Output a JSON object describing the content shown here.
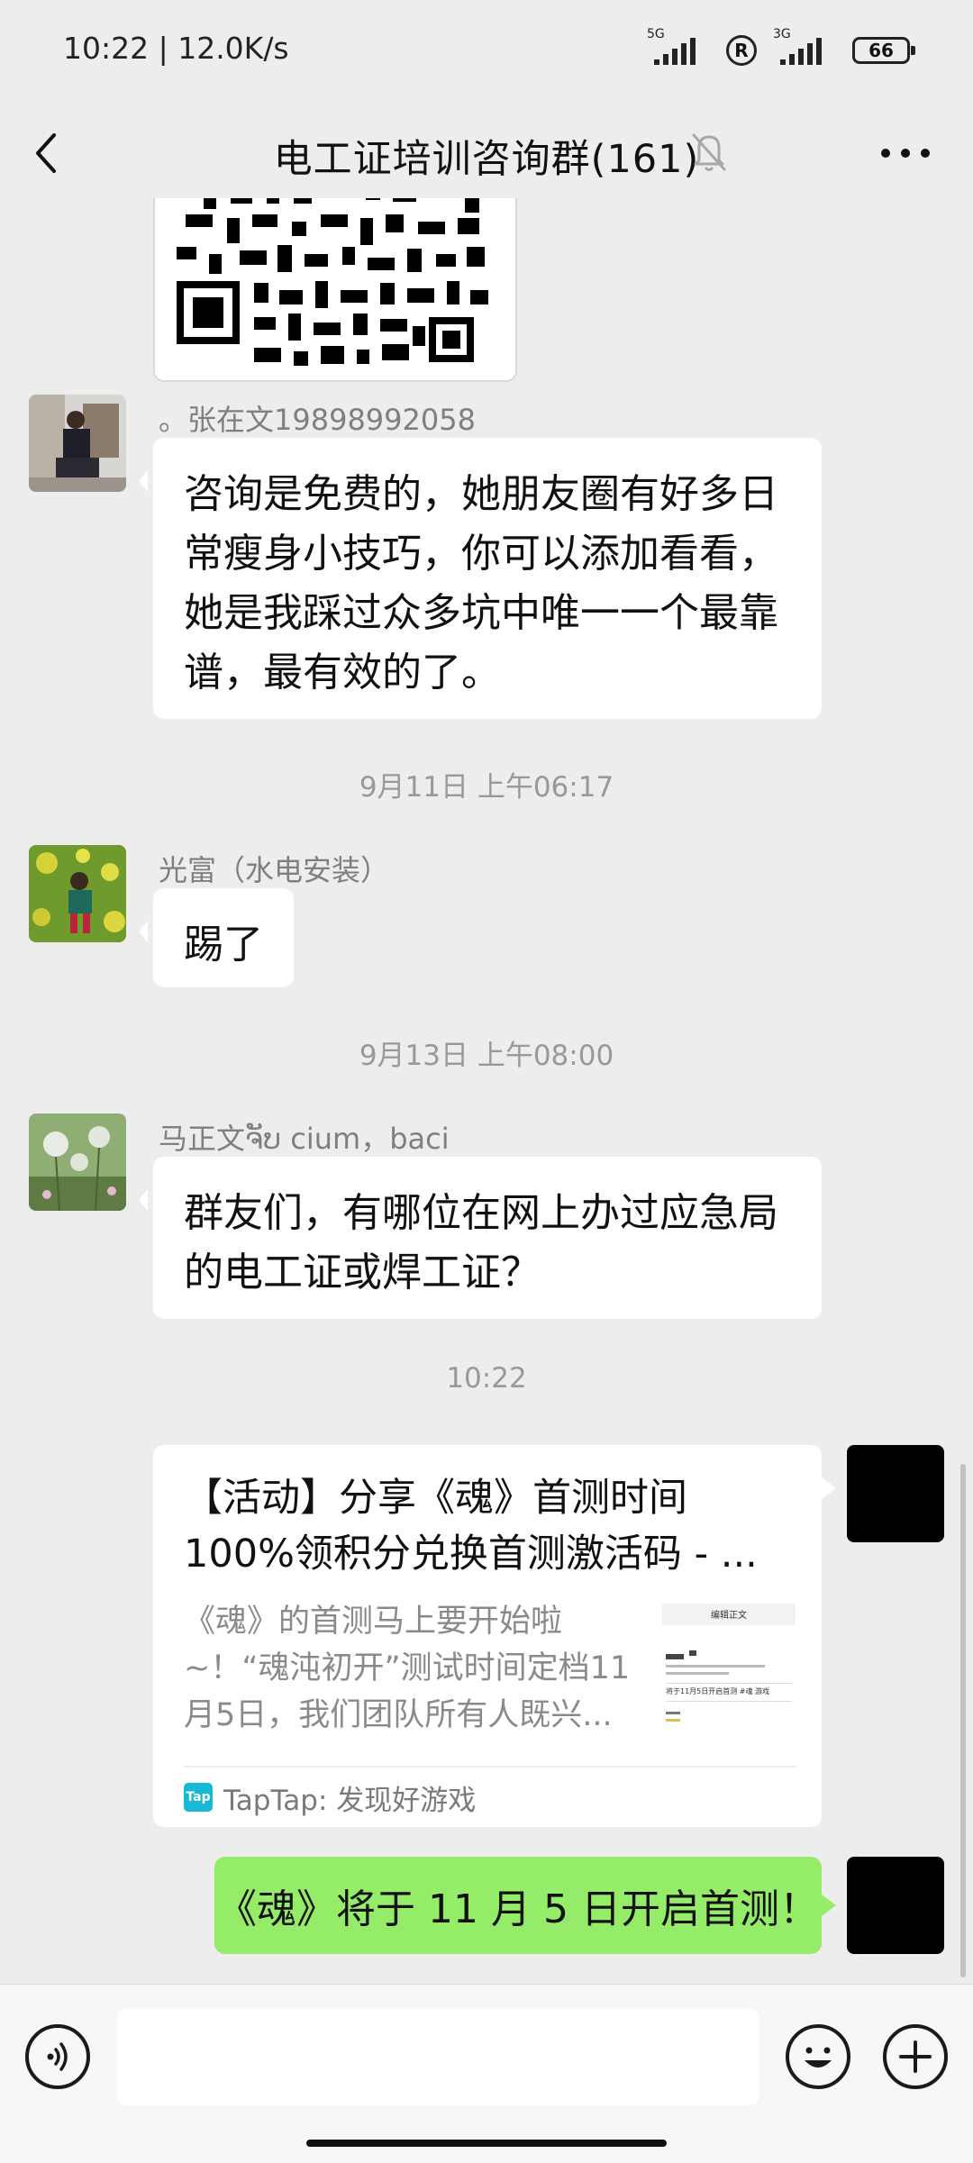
{
  "status_bar": {
    "time": "10:22 | 12.0K/s",
    "network_5g": "5G",
    "network_3g": "3G",
    "battery": "66"
  },
  "nav": {
    "title": "电工证培训咨询群(161)"
  },
  "messages": [
    {
      "sender": "。张在文19898992058",
      "text": "咨询是免费的，她朋友圈有好多日常瘦身小技巧，你可以添加看看，她是我踩过众多坑中唯一一个最靠谱，最有效的了。"
    },
    {
      "timestamp": "9月11日 上午06:17",
      "sender": "光富（水电安装）",
      "text": "踢了"
    },
    {
      "timestamp": "9月13日 上午08:00",
      "sender": "马正文ຈັບ cium，baci",
      "text": "群友们，有哪位在网上办过应急局的电工证或焊工证？"
    }
  ],
  "time_divider": "10:22",
  "link_card": {
    "title": "【活动】分享《魂》首测时间 100%领积分兑换首测激活码 - ...",
    "description": "《魂》的首测马上要开始啦~！“魂沌初开”测试时间定档11月5日，我们团队所有人既兴...",
    "source": "TapTap: 发现好游戏",
    "logo_text": "Tap",
    "thumb_header": "编辑正文",
    "thumb_line": "将于11月5日开启首测 #魂 游戏"
  },
  "own_message": "《魂》将于 11 月 5 日开启首测！",
  "input": {
    "placeholder": ""
  }
}
